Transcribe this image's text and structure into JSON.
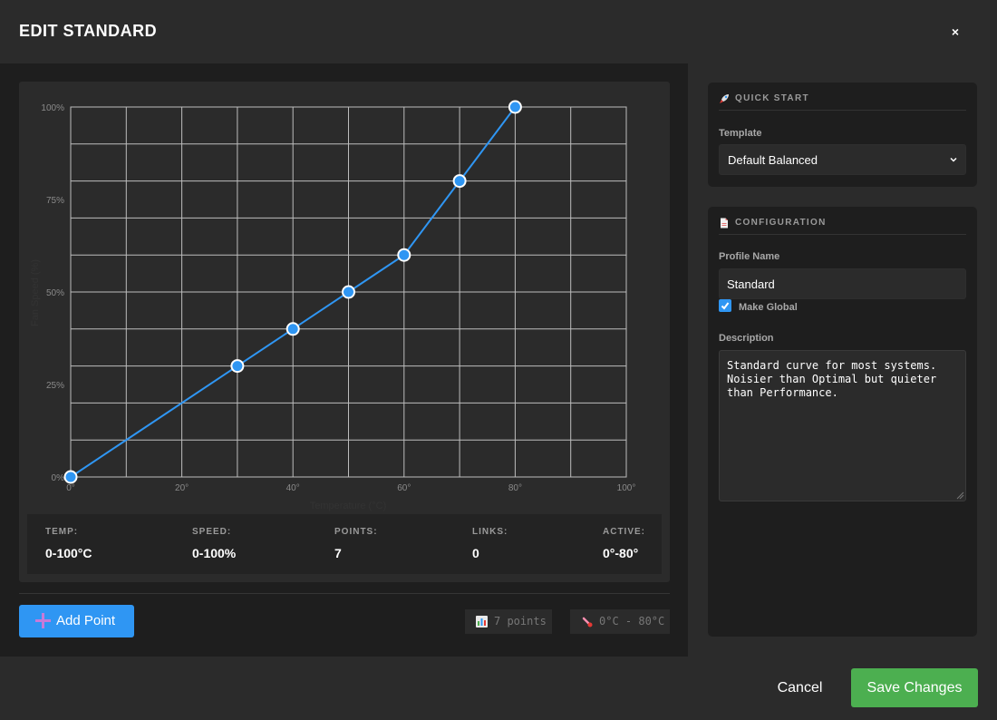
{
  "header": {
    "title": "EDIT STANDARD",
    "close_label": "×"
  },
  "colors": {
    "accent": "#2f96f3",
    "success": "#4caf50",
    "curve": "#2f96f3"
  },
  "chart_data": {
    "type": "line",
    "x": [
      0,
      30,
      40,
      50,
      60,
      70,
      80
    ],
    "y": [
      0,
      30,
      40,
      50,
      60,
      80,
      100
    ],
    "xticks": [
      "0°",
      "20°",
      "40°",
      "60°",
      "80°",
      "100°"
    ],
    "yticks": [
      "100%",
      "75%",
      "50%",
      "25%",
      "0%"
    ],
    "xlabel": "Temperature (°C)",
    "ylabel": "Fan Speed (%)",
    "xlim": [
      0,
      100
    ],
    "ylim": [
      0,
      100
    ],
    "grid": true
  },
  "stats": [
    {
      "label": "TEMP:",
      "value": "0-100°C"
    },
    {
      "label": "SPEED:",
      "value": "0-100%"
    },
    {
      "label": "POINTS:",
      "value": "7"
    },
    {
      "label": "LINKS:",
      "value": "0"
    },
    {
      "label": "ACTIVE:",
      "value": "0°-80°"
    }
  ],
  "toolbar": {
    "add_point_label": "Add Point",
    "points_chip": "7 points",
    "points_icon": "bar-chart-icon",
    "range_chip": "0°C - 80°C",
    "range_icon": "thermometer-icon"
  },
  "quick_start": {
    "title": "QUICK START",
    "icon": "rocket-icon",
    "template_label": "Template",
    "template_value": "Default Balanced"
  },
  "configuration": {
    "title": "CONFIGURATION",
    "icon": "document-icon",
    "profile_name_label": "Profile Name",
    "profile_name_value": "Standard",
    "make_global_label": "Make Global",
    "make_global_checked": true,
    "description_label": "Description",
    "description_value": "Standard curve for most systems.\nNoisier than Optimal but quieter\nthan Performance."
  },
  "footer": {
    "cancel_label": "Cancel",
    "save_label": "Save Changes"
  }
}
